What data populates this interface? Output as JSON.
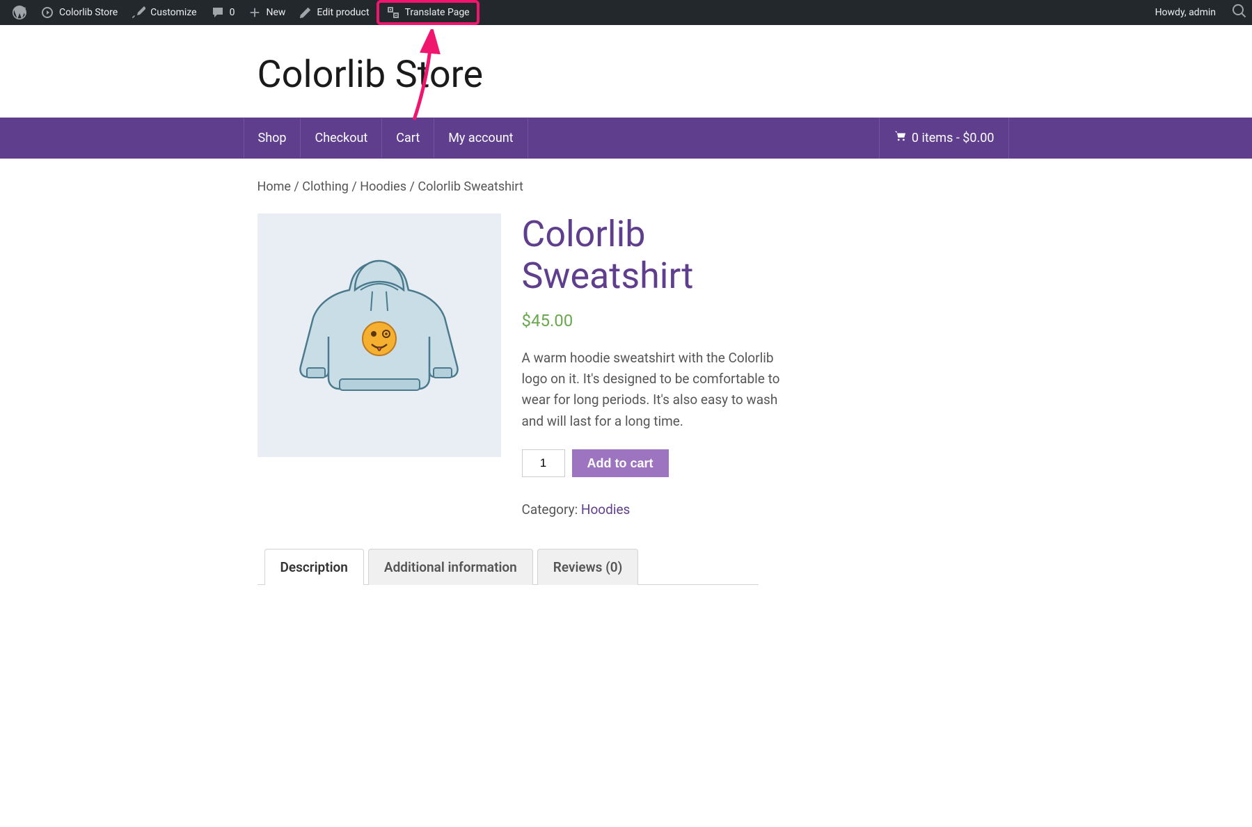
{
  "adminbar": {
    "site_name": "Colorlib Store",
    "customize": "Customize",
    "comments_count": "0",
    "new_label": "New",
    "edit_product": "Edit product",
    "translate_page": "Translate Page",
    "howdy": "Howdy, admin"
  },
  "header": {
    "site_title": "Colorlib Store"
  },
  "nav": {
    "items": [
      {
        "label": "Shop"
      },
      {
        "label": "Checkout"
      },
      {
        "label": "Cart"
      },
      {
        "label": "My account"
      }
    ],
    "cart_text": "0 items - $0.00"
  },
  "breadcrumb": {
    "home": "Home",
    "cat1": "Clothing",
    "cat2": "Hoodies",
    "current": "Colorlib Sweatshirt",
    "sep": " / "
  },
  "product": {
    "title": "Colorlib Sweatshirt",
    "price": "$45.00",
    "description": "A warm hoodie sweatshirt with the Colorlib logo on it. It's designed to be comfortable to wear for long periods. It's also easy to wash and will last for a long time.",
    "qty_value": "1",
    "add_to_cart": "Add to cart",
    "category_label": "Category: ",
    "category_link": "Hoodies"
  },
  "tabs": {
    "description": "Description",
    "additional": "Additional information",
    "reviews": "Reviews (0)"
  },
  "colors": {
    "nav_bg": "#5f3e8e",
    "accent": "#9c74bf",
    "highlight": "#f0166e"
  }
}
